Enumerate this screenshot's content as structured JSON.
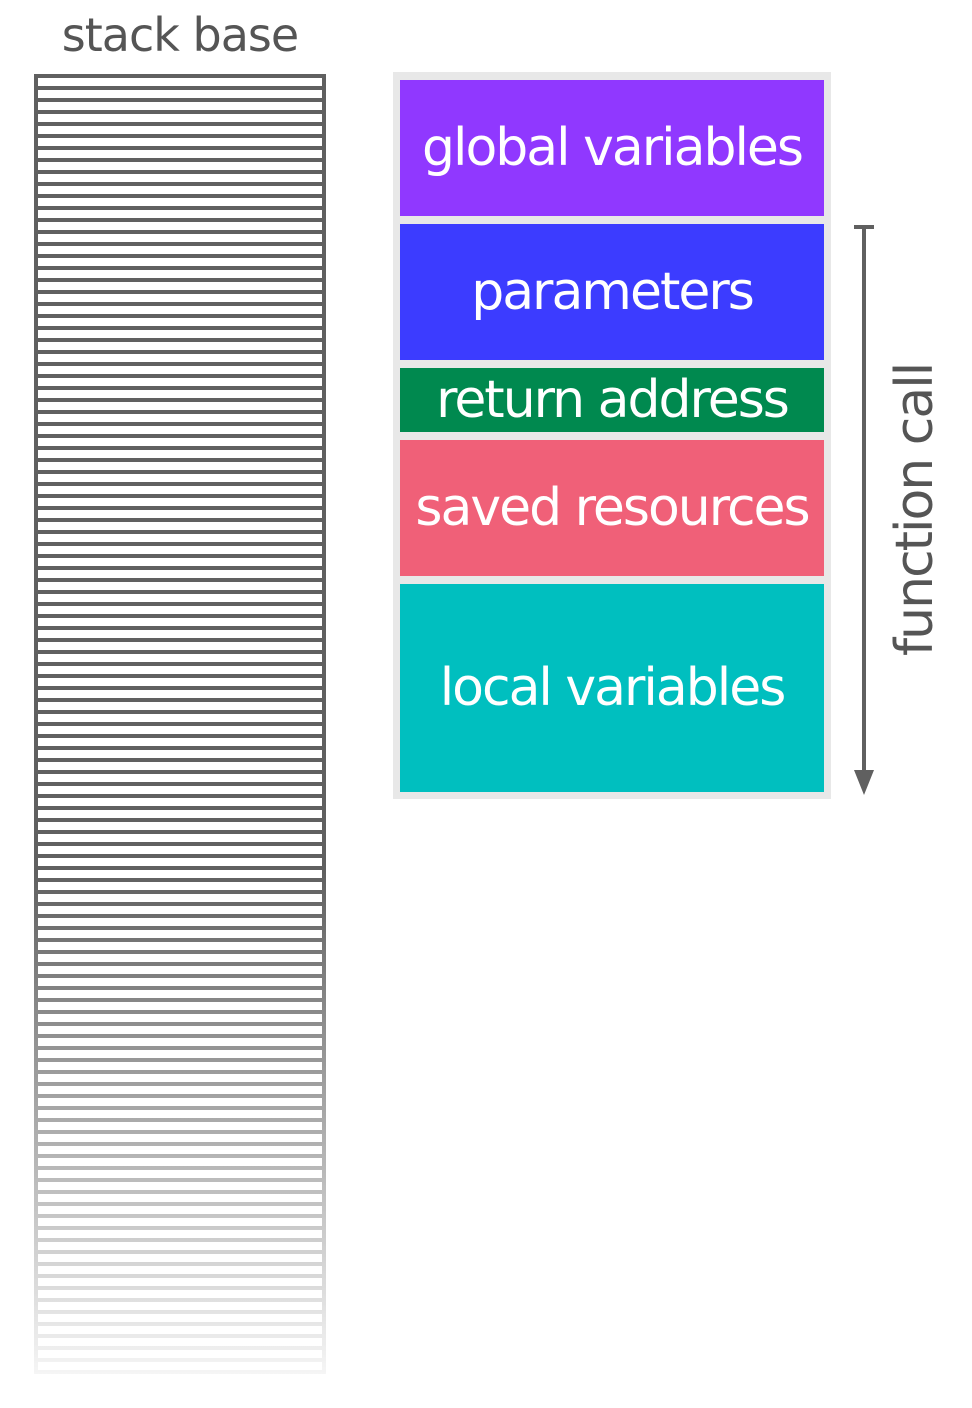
{
  "stack": {
    "label": "stack base",
    "line_color": "#606060"
  },
  "frame": {
    "blocks": [
      {
        "label": "global variables",
        "color": "#9038ff"
      },
      {
        "label": "parameters",
        "color": "#3c3cff"
      },
      {
        "label": "return address",
        "color": "#00894f"
      },
      {
        "label": "saved resources",
        "color": "#f06078"
      },
      {
        "label": "local variables",
        "color": "#00bfbf"
      }
    ],
    "background": "#e8e8e8"
  },
  "arrow": {
    "label": "function call",
    "direction": "down",
    "color": "#606060"
  }
}
